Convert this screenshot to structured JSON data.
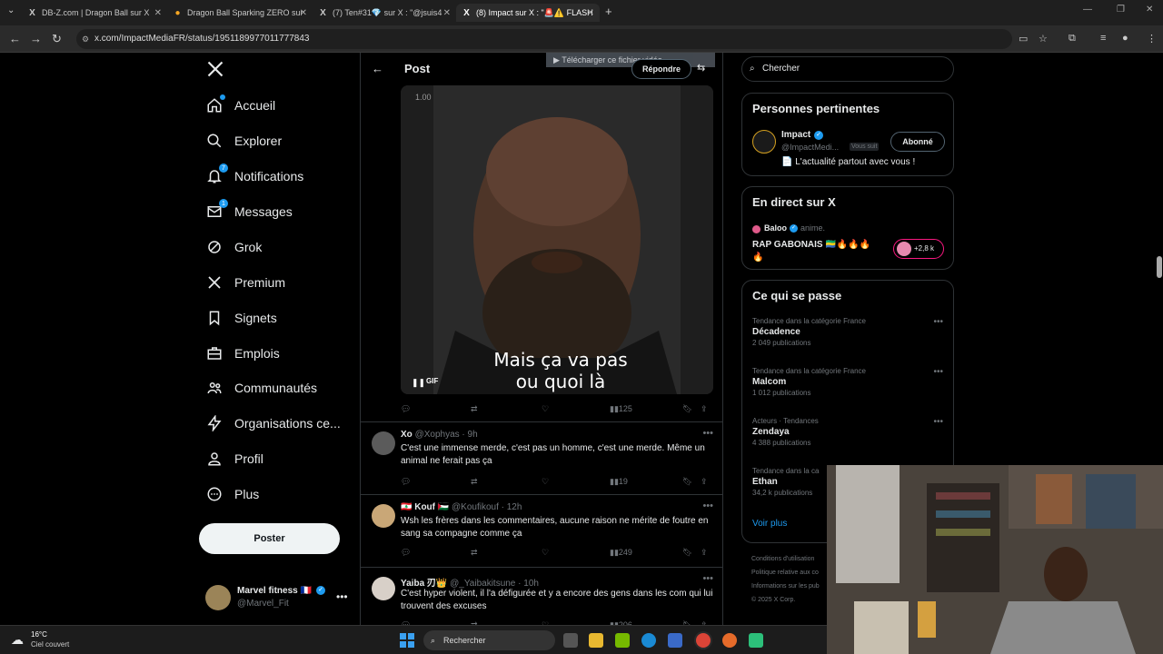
{
  "browser": {
    "tabs": [
      {
        "label": "DB-Z.com | Dragon Ball sur X",
        "icon": "X"
      },
      {
        "label": "Dragon Ball Sparking ZERO sur",
        "icon": "●"
      },
      {
        "label": "(7) Ten#31💎 sur X : \"@jsuis4",
        "icon": "X"
      },
      {
        "label": "(8) Impact sur X : \"🚨⚠️ FLASH",
        "icon": "X"
      }
    ],
    "url": "x.com/ImpactMediaFR/status/1951189977011777843"
  },
  "nav": {
    "items": [
      {
        "label": "Accueil",
        "icon": "home-icon"
      },
      {
        "label": "Explorer",
        "icon": "search-icon"
      },
      {
        "label": "Notifications",
        "icon": "bell-icon",
        "badge": "7"
      },
      {
        "label": "Messages",
        "icon": "mail-icon",
        "badge": "1"
      },
      {
        "label": "Grok",
        "icon": "grok-icon"
      },
      {
        "label": "Premium",
        "icon": "x-logo-icon"
      },
      {
        "label": "Signets",
        "icon": "bookmark-icon"
      },
      {
        "label": "Emplois",
        "icon": "briefcase-icon"
      },
      {
        "label": "Communautés",
        "icon": "people-icon"
      },
      {
        "label": "Organisations ce...",
        "icon": "lightning-icon"
      },
      {
        "label": "Profil",
        "icon": "person-icon"
      },
      {
        "label": "Plus",
        "icon": "more-circle-icon"
      }
    ],
    "post_button": "Poster",
    "profile": {
      "name": "Marvel fitness 🇫🇷",
      "handle": "@Marvel_Fit"
    }
  },
  "main": {
    "header_title": "Post",
    "reply_button": "Répondre",
    "download_overlay": "▶ Télécharger ce fichier vidéo",
    "video": {
      "timestamp": "1.00",
      "caption_line1": "Mais ça va pas",
      "caption_line2": "ou quoi là",
      "gif_label": "GIF"
    },
    "post_actions": {
      "views": "125"
    },
    "replies": [
      {
        "name": "Xo",
        "handle": "@Xophyas · 9h",
        "text": "C'est une immense merde, c'est pas un homme, c'est une merde. Même un animal ne ferait pas ça",
        "views": "19"
      },
      {
        "name": "🇱🇧 Kouf 🇵🇸",
        "handle": "@Koufikouf · 12h",
        "text": "Wsh les frères dans les commentaires, aucune raison ne mérite de foutre en sang sa compagne comme ça",
        "views": "249"
      },
      {
        "name": "Yaiba 刃👑",
        "handle": "@_Yaibakitsune · 10h",
        "text": "C'est hyper violent, il l'a défigurée et y a encore des gens dans les com qui lui trouvent des excuses",
        "views": "206"
      }
    ]
  },
  "right": {
    "search_placeholder": "Chercher",
    "relevant": {
      "title": "Personnes pertinentes",
      "name": "Impact",
      "handle": "@ImpactMedi...",
      "follows_you": "Vous suit",
      "follow_button": "Abonné",
      "bio": "📄 L'actualité partout avec vous !"
    },
    "live": {
      "title": "En direct sur X",
      "host": "Baloo",
      "host_suffix": "anime.",
      "stream_title": "RAP GABONAIS 🇬🇦🔥🔥🔥🔥",
      "listeners": "+2,8 k"
    },
    "trends": {
      "title": "Ce qui se passe",
      "items": [
        {
          "category": "Tendance dans la catégorie France",
          "name": "Décadence",
          "count": "2 049 publications"
        },
        {
          "category": "Tendance dans la catégorie France",
          "name": "Malcom",
          "count": "1 012 publications"
        },
        {
          "category": "Acteurs · Tendances",
          "name": "Zendaya",
          "count": "4 388 publications"
        },
        {
          "category": "Tendance dans la ca",
          "name": "Ethan",
          "count": "34,2 k publications"
        }
      ],
      "show_more": "Voir plus"
    },
    "footer": [
      "Conditions d'utilisation",
      "Politique relative aux co",
      "Informations sur les pub",
      "© 2025 X Corp."
    ]
  },
  "taskbar": {
    "weather_temp": "16°C",
    "weather_desc": "Ciel couvert",
    "search_label": "Rechercher"
  },
  "colors": {
    "accent": "#1d9bf0",
    "background": "#000000",
    "border": "#2f3336",
    "muted": "#71767b"
  }
}
